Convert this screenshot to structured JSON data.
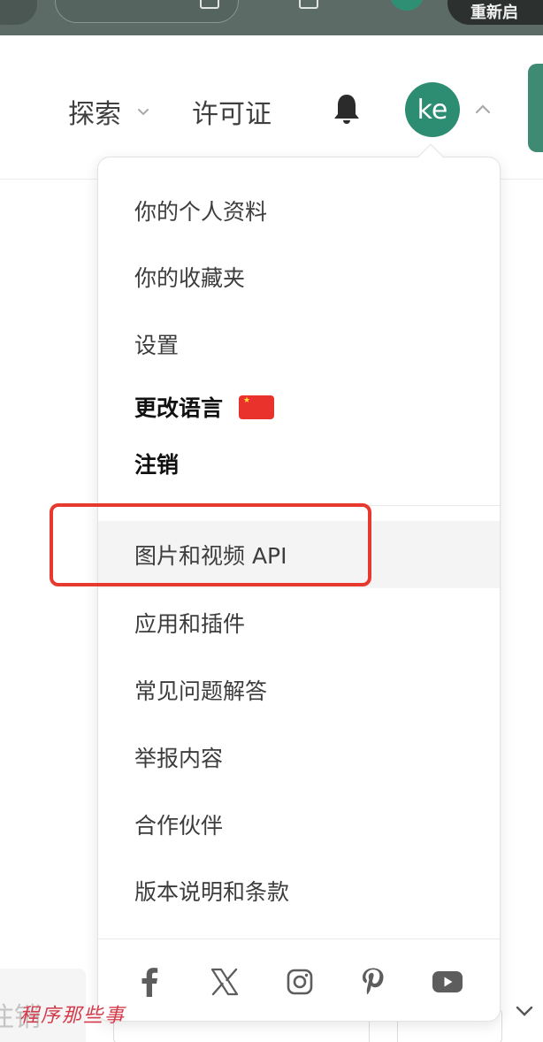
{
  "browser": {
    "right_pill_text": "重新启"
  },
  "header": {
    "explore_label": "探索",
    "license_label": "许可证",
    "avatar_initials": "ke"
  },
  "menu": {
    "items": [
      {
        "label": "你的个人资料"
      },
      {
        "label": "你的收藏夹"
      },
      {
        "label": "设置"
      },
      {
        "label": "更改语言"
      },
      {
        "label": "注销"
      },
      {
        "label": "图片和视频 API"
      },
      {
        "label": "应用和插件"
      },
      {
        "label": "常见问题解答"
      },
      {
        "label": "举报内容"
      },
      {
        "label": "合作伙伴"
      },
      {
        "label": "版本说明和条款"
      }
    ],
    "language_flag": "china-flag-icon",
    "socials": [
      "facebook-icon",
      "x-icon",
      "instagram-icon",
      "pinterest-icon",
      "youtube-icon"
    ]
  },
  "background": {
    "left_fragment": "注销",
    "watermark": "程序那些事"
  },
  "colors": {
    "accent": "#2d8d73",
    "annotation": "#e8392f"
  }
}
